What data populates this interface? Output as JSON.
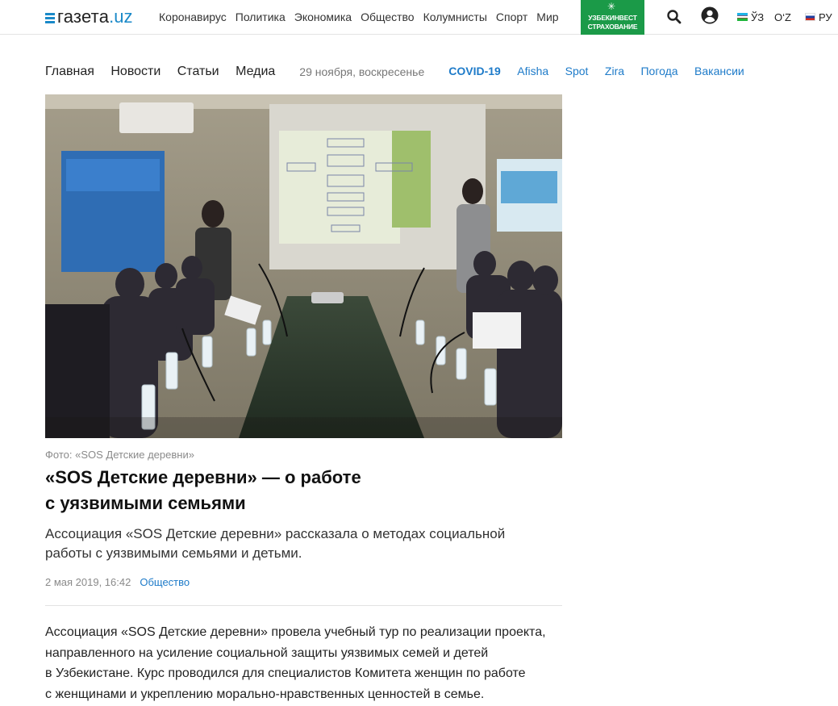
{
  "header": {
    "logo": {
      "text": "газета",
      "suffix": ".uz"
    },
    "nav": [
      "Коронавирус",
      "Политика",
      "Экономика",
      "Общество",
      "Колумнисты",
      "Спорт",
      "Мир"
    ],
    "promo": {
      "line1": "УЗБЕКИНВЕСТ",
      "line2": "СТРАХОВАНИЕ",
      "color": "#1b9a48"
    },
    "languages": [
      {
        "label": "ЎЗ",
        "flag": "uz"
      },
      {
        "label": "O‘Z",
        "flag": "none"
      },
      {
        "label": "РУ",
        "flag": "ru"
      }
    ],
    "icons": {
      "search": "search-icon",
      "user": "user-icon"
    }
  },
  "secondary_nav": {
    "main": [
      "Главная",
      "Новости",
      "Статьи",
      "Медиа"
    ],
    "date": "29 ноября, воскресенье",
    "projects": [
      "COVID-19",
      "Afisha",
      "Spot",
      "Zira",
      "Погода",
      "Вакансии"
    ],
    "accent": "#1e7bc9"
  },
  "article": {
    "photo_caption": "Фото: «SOS Детские деревни»",
    "title": "«SOS Детские деревни» — о работе с уязвимыми семьями",
    "title_line1": "«SOS Детские деревни» — о работе",
    "title_line2": "с уязвимыми семьями",
    "lead_line1": "Ассоциация «SOS Детские деревни» рассказала о методах социальной",
    "lead_line2": "работы с уязвимыми семьями и детьми.",
    "published": "2 мая 2019, 16:42",
    "category": "Общество",
    "body": [
      "Ассоциация «SOS Детские деревни» провела учебный тур по реализации проекта,",
      "направленного на усиление социальной защиты уязвимых семей и детей",
      "в Узбекистане. Курс проводился для специалистов Комитета женщин по работе",
      "с женщинами и укреплению морально-нравственных ценностей в семье."
    ]
  }
}
